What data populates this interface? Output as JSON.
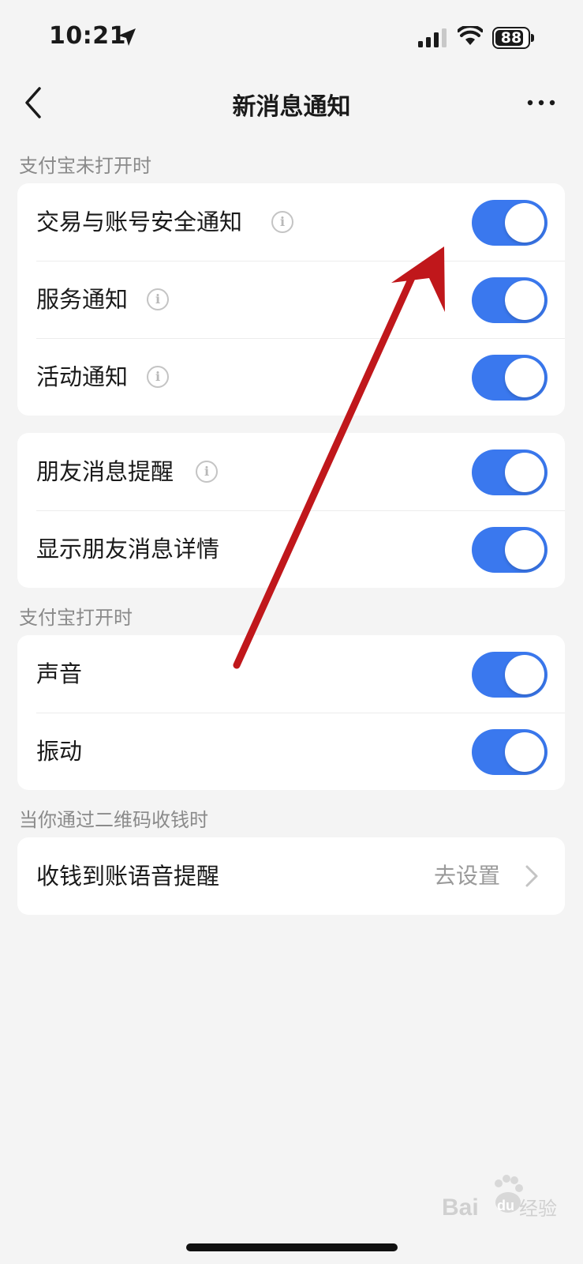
{
  "status_bar": {
    "time": "10:21",
    "battery": "88",
    "battery_level": 0.88,
    "icons": [
      "location-arrow-icon",
      "signal-icon",
      "wifi-icon",
      "battery-icon"
    ]
  },
  "nav": {
    "title": "新消息通知",
    "back_icon": "chevron-left-icon",
    "more_icon": "more-icon"
  },
  "sections": {
    "closed": {
      "label": "支付宝未打开时"
    },
    "open": {
      "label": "支付宝打开时"
    },
    "qrcode": {
      "label": "当你通过二维码收钱时"
    }
  },
  "closed_items": [
    {
      "label": "交易与账号安全通知",
      "info": true,
      "on": true
    },
    {
      "label": "服务通知",
      "info": true,
      "on": true
    },
    {
      "label": "活动通知",
      "info": true,
      "on": true
    }
  ],
  "friend_items": [
    {
      "label": "朋友消息提醒",
      "info": true,
      "on": true
    },
    {
      "label": "显示朋友消息详情",
      "info": false,
      "on": true
    }
  ],
  "open_items": [
    {
      "label": "声音",
      "on": true
    },
    {
      "label": "振动",
      "on": true
    }
  ],
  "voice_item": {
    "label": "收钱到账语音提醒",
    "value": "去设置"
  },
  "info_glyph": "i",
  "watermark": {
    "text": "Bai",
    "text2": "du",
    "text3": "经验"
  },
  "colors": {
    "accent": "#3a78ee",
    "background": "#f4f4f4",
    "arrow": "#c0171b"
  }
}
